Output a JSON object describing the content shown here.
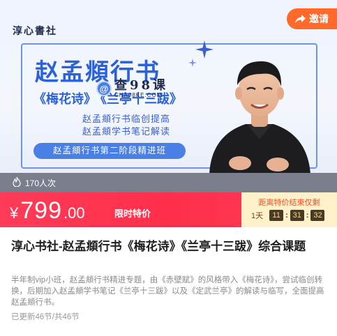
{
  "banner": {
    "brand": "淳心書社",
    "title": "赵孟頫行书",
    "poem_left": "《梅花诗》",
    "poem_right": "《兰亭十三跋》",
    "line1": "赵孟頫行书临创提高",
    "line2": "赵孟頫学书笔记解读",
    "pill": "赵孟頫行书第二阶段精进班",
    "watermark_main": "查98课",
    "watermark_sub": "CHA98KE.COM",
    "watermark_icon": "@"
  },
  "invite": {
    "label": "邀请",
    "icon": "share-arrow-icon"
  },
  "stats": {
    "views": "170人次",
    "icon": "flame-icon"
  },
  "price": {
    "currency": "¥",
    "integer": "799",
    "decimal": ".00",
    "label": "限时特价"
  },
  "countdown": {
    "title": "距离特价结束仅剩",
    "day": "1天",
    "hours": "11",
    "minutes": "31",
    "seconds": "32"
  },
  "course": {
    "title": "淳心书社-赵孟頫行书《梅花诗》《兰亭十三跋》综合课题",
    "description": "半年制vip小班，赵孟頫行书精进专题，由《赤壁赋》的风格带入《梅花诗》，尝试临创转换，后期加入赵孟頫学书笔记《兰亭十三跋》以及《定武兰亭》的解读与临写，全面提高赵孟頫行书。",
    "progress": "已更新46节/共46节"
  },
  "colors": {
    "accent_blue": "#2b62d9",
    "price_red": "#ff2f4b",
    "invite_orange": "#ff6a2b",
    "countdown_bg": "#fff1c9"
  }
}
